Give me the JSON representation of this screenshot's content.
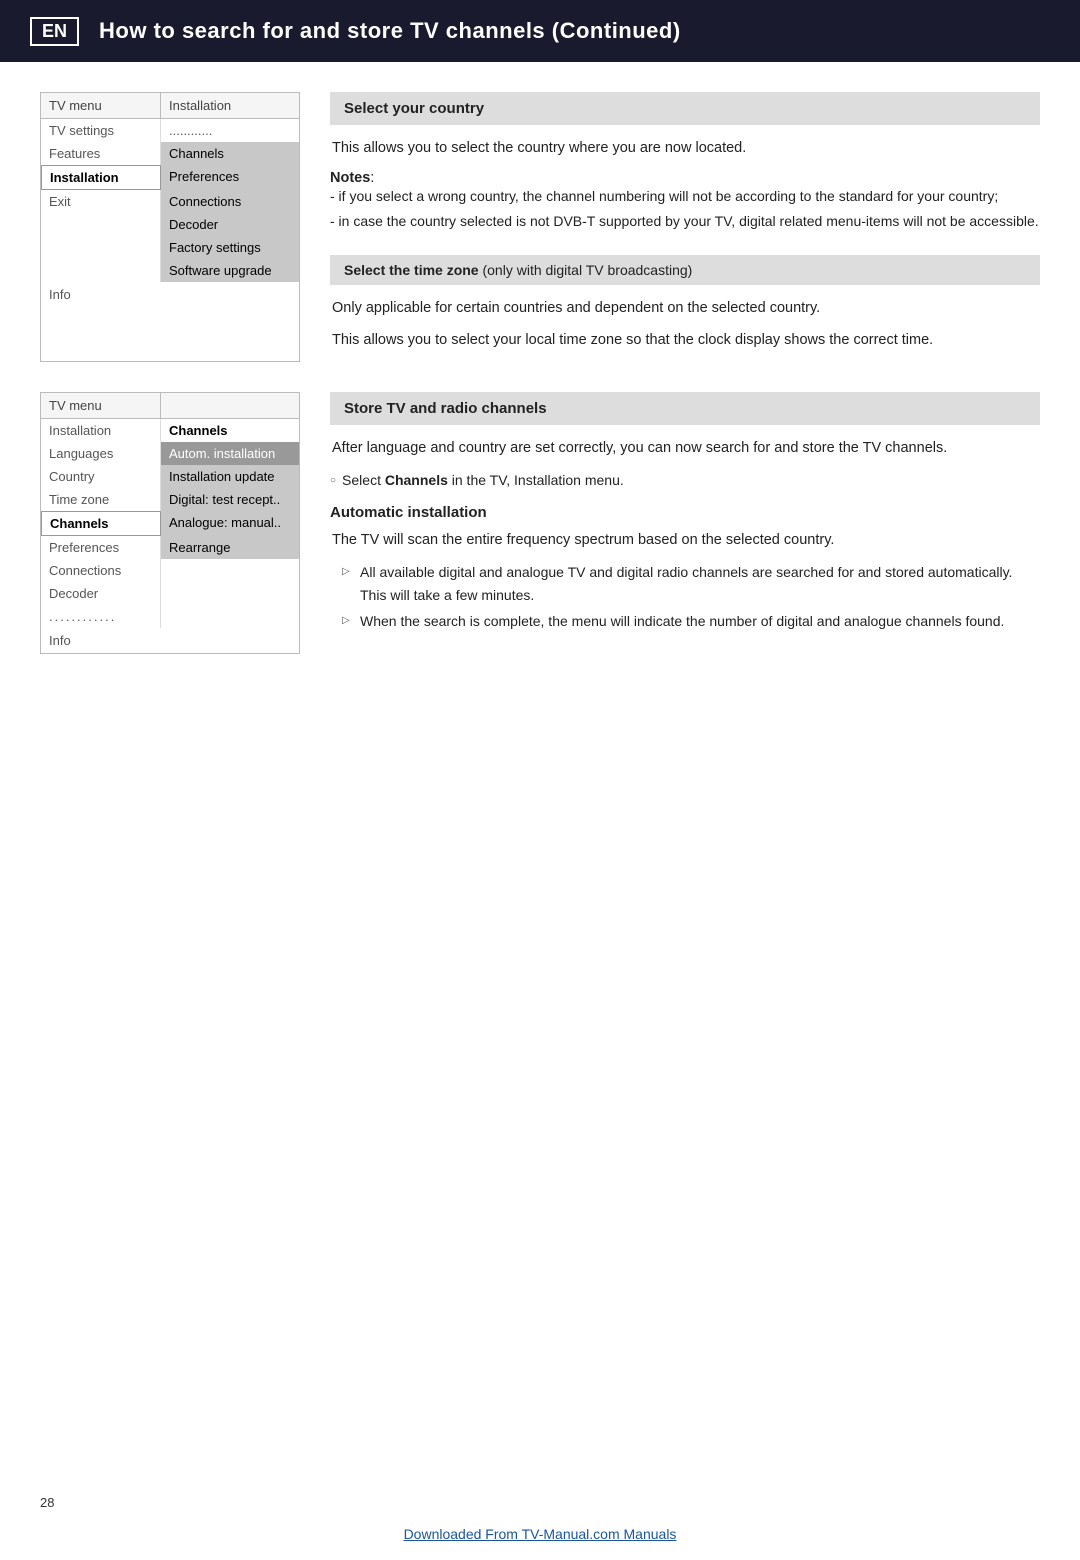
{
  "header": {
    "badge": "EN",
    "title": "How to search for and store TV channels  (Continued)"
  },
  "menu1": {
    "col_left": "TV menu",
    "col_right": "Installation",
    "items": [
      {
        "left": "TV settings",
        "right": "............",
        "left_style": "",
        "right_style": ""
      },
      {
        "left": "Features",
        "right": "Channels",
        "left_style": "",
        "right_style": "light-gray"
      },
      {
        "left": "Installation",
        "right": "Preferences",
        "left_style": "active",
        "right_style": "light-gray"
      },
      {
        "left": "Exit",
        "right": "Connections",
        "left_style": "",
        "right_style": "light-gray"
      },
      {
        "left": "",
        "right": "Decoder",
        "left_style": "",
        "right_style": "light-gray"
      },
      {
        "left": "",
        "right": "Factory settings",
        "left_style": "",
        "right_style": "light-gray"
      },
      {
        "left": "",
        "right": "Software upgrade",
        "left_style": "",
        "right_style": "light-gray"
      }
    ],
    "info": "Info"
  },
  "select_country": {
    "heading": "Select your country",
    "description": "This allows you to select the country where you are now located.",
    "notes_label": "Notes",
    "notes": [
      "- if you select a wrong country, the channel numbering will not be according to the standard for your country;",
      "- in case the country selected is not DVB-T supported by your TV, digital related menu-items will not be accessible."
    ]
  },
  "select_timezone": {
    "heading_bold": "Select the time zone",
    "heading_normal": " (only with digital TV broadcasting)",
    "para1": "Only applicable for certain countries and dependent on the selected country.",
    "para2": "This allows you to select your local time zone so that the clock display shows the correct time."
  },
  "menu2": {
    "col_left": "TV menu",
    "heading_right": "Channels",
    "items": [
      {
        "left": "Installation",
        "right": "",
        "left_style": "",
        "right_style": ""
      },
      {
        "left": "Languages",
        "right": "Autom. installation",
        "left_style": "",
        "right_style": "medium-gray"
      },
      {
        "left": "Country",
        "right": "Installation update",
        "left_style": "",
        "right_style": "light-gray"
      },
      {
        "left": "Time zone",
        "right": "Digital: test recept..",
        "left_style": "",
        "right_style": "light-gray"
      },
      {
        "left": "Channels",
        "right": "Analogue: manual..",
        "left_style": "active",
        "right_style": "light-gray"
      },
      {
        "left": "Preferences",
        "right": "Rearrange",
        "left_style": "",
        "right_style": "light-gray"
      },
      {
        "left": "Connections",
        "right": "",
        "left_style": "",
        "right_style": ""
      },
      {
        "left": "Decoder",
        "right": "",
        "left_style": "",
        "right_style": ""
      },
      {
        "left": "............",
        "right": "",
        "left_style": "dotted",
        "right_style": ""
      }
    ],
    "info": "Info"
  },
  "store_tv": {
    "heading": "Store TV and radio channels",
    "intro": "After language and country are set correctly, you can now search for and store the TV channels.",
    "select_note": "Select Channels in the TV, Installation menu.",
    "auto_heading": "Automatic installation",
    "auto_desc": "The TV will scan the entire frequency spectrum based on the selected country.",
    "bullets": [
      "All available digital and analogue TV and digital radio channels are searched for and stored automatically. This will take a few minutes.",
      "When the search is complete, the menu will indicate the number of digital and analogue channels found."
    ]
  },
  "bottom": {
    "page_number": "28",
    "link_text": "Downloaded From TV-Manual.com Manuals",
    "link_url": "#"
  }
}
